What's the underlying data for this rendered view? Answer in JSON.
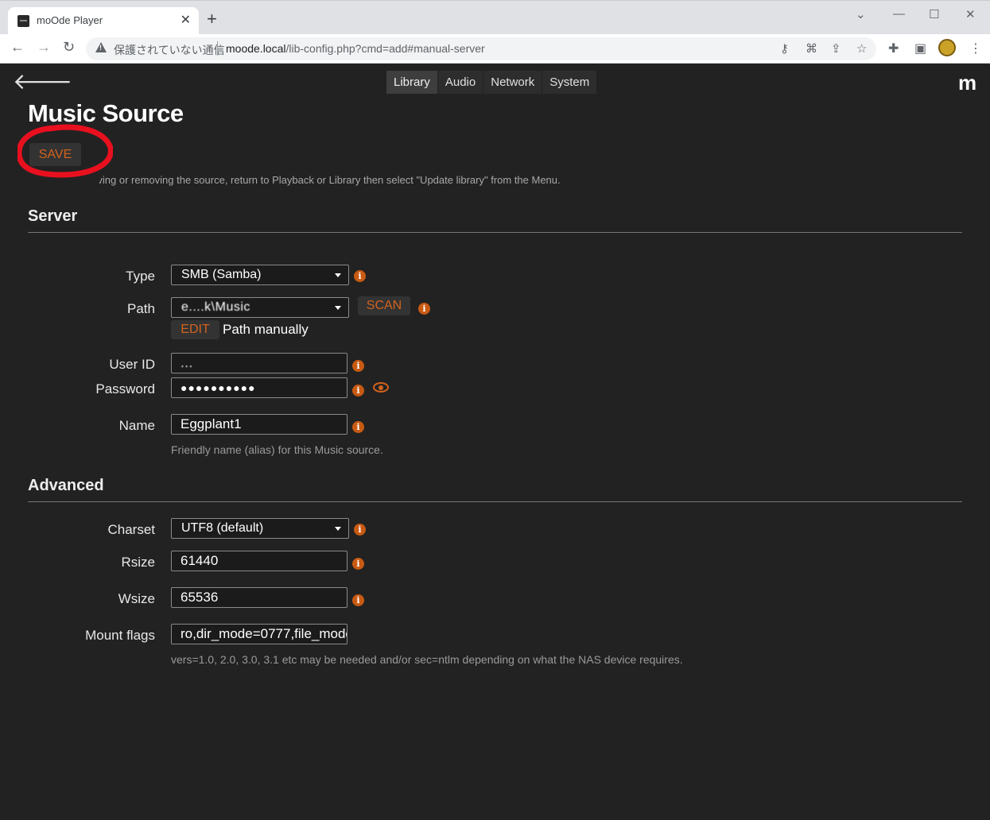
{
  "browser": {
    "tab_title": "moOde Player",
    "security_text": "保護されていない通信",
    "url_host": "moode.local",
    "url_path": "/lib-config.php?cmd=add#manual-server"
  },
  "nav": {
    "tabs": [
      "Library",
      "Audio",
      "Network",
      "System"
    ],
    "active": "Library",
    "logo": "m"
  },
  "page": {
    "title": "Music Source",
    "save_label": "SAVE",
    "note": "NOTE: After saving or removing the source, return to Playback or Library then select \"Update library\" from the Menu."
  },
  "server": {
    "heading": "Server",
    "type_label": "Type",
    "type_value": "SMB (Samba)",
    "path_label": "Path",
    "path_value": "e....k\\Music",
    "scan_label": "SCAN",
    "edit_label": "EDIT",
    "path_manually_label": "Path manually",
    "userid_label": "User ID",
    "userid_value": "...",
    "password_label": "Password",
    "password_value": "●●●●●●●●●●",
    "name_label": "Name",
    "name_value": "Eggplant1",
    "name_help": "Friendly name (alias) for this Music source."
  },
  "advanced": {
    "heading": "Advanced",
    "charset_label": "Charset",
    "charset_value": "UTF8 (default)",
    "rsize_label": "Rsize",
    "rsize_value": "61440",
    "wsize_label": "Wsize",
    "wsize_value": "65536",
    "mountflags_label": "Mount flags",
    "mountflags_value": "ro,dir_mode=0777,file_mode",
    "mountflags_help": "vers=1.0, 2.0, 3.0, 3.1 etc may be needed and/or sec=ntlm depending on what the NAS device requires."
  },
  "colors": {
    "accent": "#d2631d",
    "background": "#222222",
    "annotation": "#e8101f"
  }
}
